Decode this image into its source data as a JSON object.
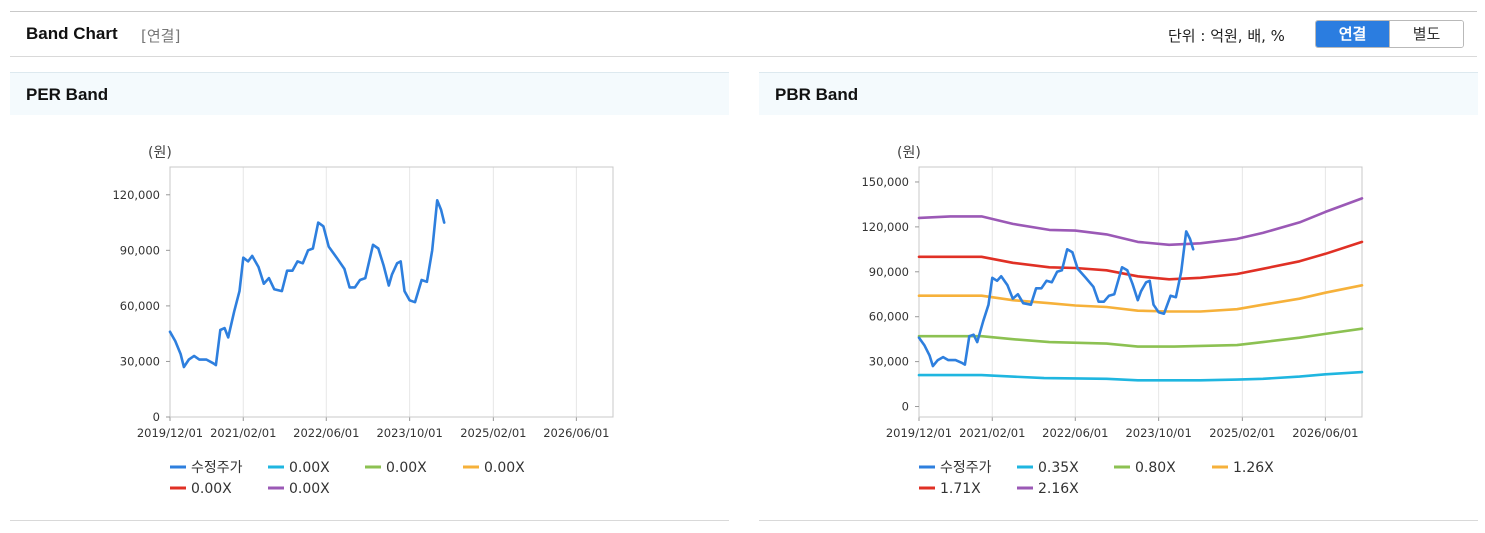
{
  "header": {
    "title": "Band Chart",
    "scope": "[연결]",
    "unit": "단위 : 억원, 배, %",
    "toggle": {
      "consolidated": "연결",
      "separate": "별도",
      "selected": "연결"
    }
  },
  "chart_data": [
    {
      "type": "line",
      "panel_title": "PER Band",
      "ylabel": "(원)",
      "ylim": [
        0,
        135000
      ],
      "yticks": [
        0,
        30000,
        60000,
        90000,
        120000
      ],
      "ytick_labels": [
        "0",
        "30,000",
        "60,000",
        "90,000",
        "120,000"
      ],
      "xlim": [
        "2019-12-01",
        "2027-01-01"
      ],
      "xtick_labels": [
        "2019/12/01",
        "2021/02/01",
        "2022/06/01",
        "2023/10/01",
        "2025/02/01",
        "2026/06/01"
      ],
      "grid": "vertical",
      "legend_placement": "bottom",
      "series": [
        {
          "name": "수정주가",
          "color": "#2e7fde",
          "points": [
            [
              "2019-12-01",
              46000
            ],
            [
              "2020-01-01",
              41000
            ],
            [
              "2020-02-01",
              34000
            ],
            [
              "2020-02-20",
              27000
            ],
            [
              "2020-03-20",
              31000
            ],
            [
              "2020-04-20",
              33000
            ],
            [
              "2020-05-20",
              31000
            ],
            [
              "2020-07-01",
              31000
            ],
            [
              "2020-08-10",
              29000
            ],
            [
              "2020-08-25",
              28000
            ],
            [
              "2020-09-20",
              47000
            ],
            [
              "2020-10-15",
              48000
            ],
            [
              "2020-11-05",
              43000
            ],
            [
              "2020-12-10",
              57000
            ],
            [
              "2021-01-10",
              68000
            ],
            [
              "2021-02-01",
              86000
            ],
            [
              "2021-03-01",
              84000
            ],
            [
              "2021-03-25",
              87000
            ],
            [
              "2021-05-01",
              81000
            ],
            [
              "2021-06-01",
              72000
            ],
            [
              "2021-07-01",
              75000
            ],
            [
              "2021-08-01",
              69000
            ],
            [
              "2021-09-15",
              68000
            ],
            [
              "2021-10-15",
              79000
            ],
            [
              "2021-11-15",
              79000
            ],
            [
              "2021-12-15",
              84000
            ],
            [
              "2022-01-15",
              83000
            ],
            [
              "2022-02-15",
              90000
            ],
            [
              "2022-03-15",
              91000
            ],
            [
              "2022-04-15",
              105000
            ],
            [
              "2022-05-15",
              103000
            ],
            [
              "2022-06-15",
              92000
            ],
            [
              "2022-08-01",
              86000
            ],
            [
              "2022-09-15",
              80000
            ],
            [
              "2022-10-15",
              70000
            ],
            [
              "2022-11-15",
              70000
            ],
            [
              "2022-12-15",
              74000
            ],
            [
              "2023-01-15",
              75000
            ],
            [
              "2023-03-01",
              93000
            ],
            [
              "2023-04-01",
              91000
            ],
            [
              "2023-05-01",
              82000
            ],
            [
              "2023-06-01",
              71000
            ],
            [
              "2023-06-20",
              77000
            ],
            [
              "2023-07-20",
              83000
            ],
            [
              "2023-08-10",
              84000
            ],
            [
              "2023-09-01",
              68000
            ],
            [
              "2023-10-01",
              63000
            ],
            [
              "2023-11-01",
              62000
            ],
            [
              "2023-12-10",
              74000
            ],
            [
              "2024-01-10",
              73000
            ],
            [
              "2024-02-10",
              90000
            ],
            [
              "2024-03-10",
              117000
            ],
            [
              "2024-04-01",
              112000
            ],
            [
              "2024-04-20",
              105000
            ]
          ]
        },
        {
          "name": "0.00X",
          "color": "#1fb6e0",
          "points": []
        },
        {
          "name": "0.00X",
          "color": "#8cc152",
          "points": []
        },
        {
          "name": "0.00X",
          "color": "#f6b13a",
          "points": []
        },
        {
          "name": "0.00X",
          "color": "#e03025",
          "points": []
        },
        {
          "name": "0.00X",
          "color": "#9b59b6",
          "points": []
        }
      ]
    },
    {
      "type": "line",
      "panel_title": "PBR Band",
      "ylabel": "(원)",
      "ylim": [
        -7000,
        160000
      ],
      "yticks": [
        0,
        30000,
        60000,
        90000,
        120000,
        150000
      ],
      "ytick_labels": [
        "0",
        "30,000",
        "60,000",
        "90,000",
        "120,000",
        "150,000"
      ],
      "xlim": [
        "2019-12-01",
        "2027-01-01"
      ],
      "xtick_labels": [
        "2019/12/01",
        "2021/02/01",
        "2022/06/01",
        "2023/10/01",
        "2025/02/01",
        "2026/06/01"
      ],
      "grid": "vertical",
      "legend_placement": "bottom",
      "series": [
        {
          "name": "수정주가",
          "color": "#2e7fde",
          "points": [
            [
              "2019-12-01",
              46000
            ],
            [
              "2020-01-01",
              41000
            ],
            [
              "2020-02-01",
              34000
            ],
            [
              "2020-02-20",
              27000
            ],
            [
              "2020-03-20",
              31000
            ],
            [
              "2020-04-20",
              33000
            ],
            [
              "2020-05-20",
              31000
            ],
            [
              "2020-07-01",
              31000
            ],
            [
              "2020-08-10",
              29000
            ],
            [
              "2020-08-25",
              28000
            ],
            [
              "2020-09-20",
              47000
            ],
            [
              "2020-10-15",
              48000
            ],
            [
              "2020-11-05",
              43000
            ],
            [
              "2020-12-10",
              57000
            ],
            [
              "2021-01-10",
              68000
            ],
            [
              "2021-02-01",
              86000
            ],
            [
              "2021-03-01",
              84000
            ],
            [
              "2021-03-25",
              87000
            ],
            [
              "2021-05-01",
              81000
            ],
            [
              "2021-06-01",
              72000
            ],
            [
              "2021-07-01",
              75000
            ],
            [
              "2021-08-01",
              69000
            ],
            [
              "2021-09-15",
              68000
            ],
            [
              "2021-10-15",
              79000
            ],
            [
              "2021-11-15",
              79000
            ],
            [
              "2021-12-15",
              84000
            ],
            [
              "2022-01-15",
              83000
            ],
            [
              "2022-02-15",
              90000
            ],
            [
              "2022-03-15",
              91000
            ],
            [
              "2022-04-15",
              105000
            ],
            [
              "2022-05-15",
              103000
            ],
            [
              "2022-06-15",
              92000
            ],
            [
              "2022-08-01",
              86000
            ],
            [
              "2022-09-15",
              80000
            ],
            [
              "2022-10-15",
              70000
            ],
            [
              "2022-11-15",
              70000
            ],
            [
              "2022-12-15",
              74000
            ],
            [
              "2023-01-15",
              75000
            ],
            [
              "2023-03-01",
              93000
            ],
            [
              "2023-04-01",
              91000
            ],
            [
              "2023-05-01",
              82000
            ],
            [
              "2023-06-01",
              71000
            ],
            [
              "2023-06-20",
              77000
            ],
            [
              "2023-07-20",
              83000
            ],
            [
              "2023-08-10",
              84000
            ],
            [
              "2023-09-01",
              68000
            ],
            [
              "2023-10-01",
              63000
            ],
            [
              "2023-11-01",
              62000
            ],
            [
              "2023-12-10",
              74000
            ],
            [
              "2024-01-10",
              73000
            ],
            [
              "2024-02-10",
              90000
            ],
            [
              "2024-03-10",
              117000
            ],
            [
              "2024-04-01",
              112000
            ],
            [
              "2024-04-20",
              105000
            ]
          ]
        },
        {
          "name": "0.35X",
          "color": "#1fb6e0",
          "points": [
            [
              "2019-12-01",
              21000
            ],
            [
              "2020-12-01",
              21000
            ],
            [
              "2021-12-01",
              19000
            ],
            [
              "2022-12-01",
              18500
            ],
            [
              "2023-06-01",
              17500
            ],
            [
              "2024-01-01",
              17500
            ],
            [
              "2024-06-01",
              17500
            ],
            [
              "2025-01-01",
              18000
            ],
            [
              "2025-06-01",
              18500
            ],
            [
              "2026-01-01",
              20000
            ],
            [
              "2026-06-01",
              21500
            ],
            [
              "2027-01-01",
              23000
            ]
          ]
        },
        {
          "name": "0.80X",
          "color": "#8cc152",
          "points": [
            [
              "2019-12-01",
              47000
            ],
            [
              "2020-12-01",
              47000
            ],
            [
              "2021-06-01",
              45000
            ],
            [
              "2022-01-01",
              43000
            ],
            [
              "2022-12-01",
              42000
            ],
            [
              "2023-06-01",
              40000
            ],
            [
              "2024-01-01",
              40000
            ],
            [
              "2024-06-01",
              40500
            ],
            [
              "2025-01-01",
              41000
            ],
            [
              "2025-06-01",
              43000
            ],
            [
              "2026-01-01",
              46000
            ],
            [
              "2026-06-01",
              48500
            ],
            [
              "2027-01-01",
              52000
            ]
          ]
        },
        {
          "name": "1.26X",
          "color": "#f6b13a",
          "points": [
            [
              "2019-12-01",
              74000
            ],
            [
              "2020-12-01",
              74000
            ],
            [
              "2021-06-01",
              71000
            ],
            [
              "2022-01-01",
              69000
            ],
            [
              "2022-06-01",
              67500
            ],
            [
              "2022-12-01",
              66500
            ],
            [
              "2023-06-01",
              64000
            ],
            [
              "2023-12-01",
              63500
            ],
            [
              "2024-06-01",
              63500
            ],
            [
              "2025-01-01",
              65000
            ],
            [
              "2025-06-01",
              68000
            ],
            [
              "2026-01-01",
              72000
            ],
            [
              "2026-06-01",
              76000
            ],
            [
              "2027-01-01",
              81000
            ]
          ]
        },
        {
          "name": "1.71X",
          "color": "#e03025",
          "points": [
            [
              "2019-12-01",
              100000
            ],
            [
              "2020-12-01",
              100000
            ],
            [
              "2021-06-01",
              96000
            ],
            [
              "2022-01-01",
              93000
            ],
            [
              "2022-06-01",
              92500
            ],
            [
              "2022-12-01",
              91000
            ],
            [
              "2023-06-01",
              87000
            ],
            [
              "2023-12-01",
              85000
            ],
            [
              "2024-06-01",
              86000
            ],
            [
              "2025-01-01",
              88500
            ],
            [
              "2025-06-01",
              92000
            ],
            [
              "2026-01-01",
              97000
            ],
            [
              "2026-06-01",
              102000
            ],
            [
              "2027-01-01",
              110000
            ]
          ]
        },
        {
          "name": "2.16X",
          "color": "#9b59b6",
          "points": [
            [
              "2019-12-01",
              126000
            ],
            [
              "2020-06-01",
              127000
            ],
            [
              "2020-12-01",
              127000
            ],
            [
              "2021-06-01",
              122000
            ],
            [
              "2022-01-01",
              118000
            ],
            [
              "2022-06-01",
              117500
            ],
            [
              "2022-12-01",
              115000
            ],
            [
              "2023-06-01",
              110000
            ],
            [
              "2023-12-01",
              108000
            ],
            [
              "2024-06-01",
              109000
            ],
            [
              "2025-01-01",
              112000
            ],
            [
              "2025-06-01",
              116000
            ],
            [
              "2026-01-01",
              123000
            ],
            [
              "2026-06-01",
              130000
            ],
            [
              "2027-01-01",
              139000
            ]
          ]
        }
      ]
    }
  ]
}
